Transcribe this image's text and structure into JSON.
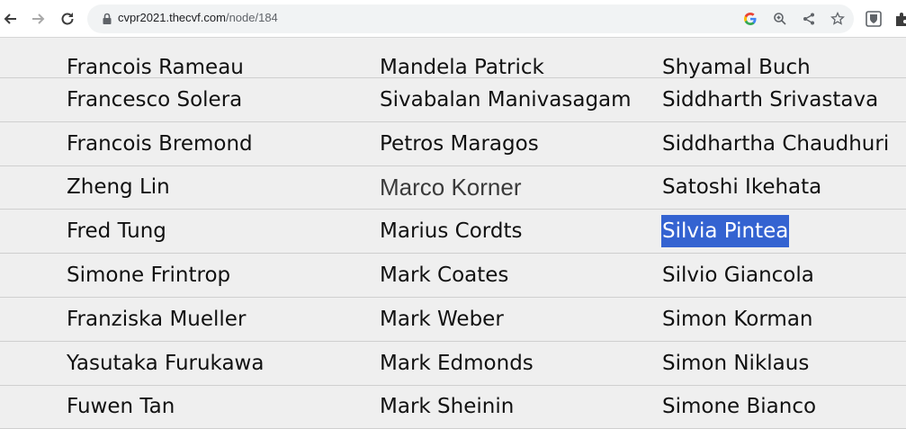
{
  "browser": {
    "url_host": "cvpr2021.thecvf.com",
    "url_path": "/node/184",
    "back_icon": "arrow-left-icon",
    "forward_icon": "arrow-right-icon",
    "reload_icon": "reload-icon"
  },
  "names": {
    "rows": [
      [
        "Francois Rameau",
        "Mandela Patrick",
        "Shyamal Buch"
      ],
      [
        "Francesco Solera",
        "Sivabalan Manivasagam",
        "Siddharth Srivastava"
      ],
      [
        "Francois Bremond",
        "Petros Maragos",
        "Siddhartha Chaudhuri"
      ],
      [
        "Zheng Lin",
        "Marco Korner",
        "Satoshi Ikehata"
      ],
      [
        "Fred Tung",
        "Marius Cordts",
        "Silvia Pintea"
      ],
      [
        "Simone Frintrop",
        "Mark Coates",
        "Silvio Giancola"
      ],
      [
        "Franziska Mueller",
        "Mark Weber",
        "Simon Korman"
      ],
      [
        "Yasutaka Furukawa",
        "Mark Edmonds",
        "Simon Niklaus"
      ],
      [
        "Fuwen Tan",
        "Mark Sheinin",
        "Simone Bianco"
      ]
    ],
    "selected_text": "Silvia Pintea",
    "selection_color": "#3463d1"
  }
}
